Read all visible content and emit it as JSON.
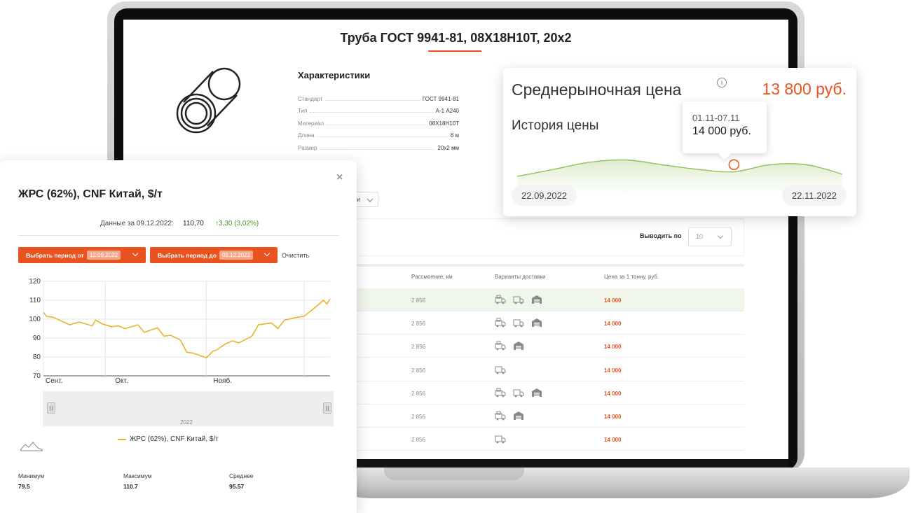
{
  "product": {
    "title": "Труба ГОСТ 9941-81, 08Х18Н10Т, 20х2",
    "chars_title": "Характеристики",
    "chars": [
      {
        "k": "Стандарт",
        "v": "ГОСТ 9941-81"
      },
      {
        "k": "Тип",
        "v": "А-1 А240"
      },
      {
        "k": "Материал",
        "v": "08Х18Н10Т"
      },
      {
        "k": "Длина",
        "v": "8 м"
      },
      {
        "k": "Размер",
        "v": "20х2 мм"
      }
    ]
  },
  "filters": {
    "dropdown_fragment": "и",
    "per_page_label": "Выводить по",
    "per_page_value": "10"
  },
  "table": {
    "headers": [
      "Рассмояние, км",
      "Варианты доставки",
      "Цена за 1 тонну, руб."
    ],
    "rows": [
      {
        "dist": "2 856",
        "price": "14 000",
        "delivery": [
          "truck-loading-icon",
          "truck-icon",
          "warehouse-icon"
        ]
      },
      {
        "dist": "2 856",
        "price": "14 000",
        "delivery": [
          "truck-loading-icon",
          "truck-icon",
          "warehouse-icon"
        ]
      },
      {
        "dist": "2 856",
        "price": "14 000",
        "delivery": [
          "truck-loading-icon",
          "warehouse-icon"
        ]
      },
      {
        "dist": "2 856",
        "price": "14 000",
        "delivery": [
          "truck-icon"
        ]
      },
      {
        "dist": "2 856",
        "price": "14 000",
        "delivery": [
          "truck-loading-icon",
          "truck-icon",
          "warehouse-icon"
        ]
      },
      {
        "dist": "2 856",
        "price": "14 000",
        "delivery": [
          "truck-loading-icon",
          "warehouse-icon"
        ]
      },
      {
        "dist": "2 856",
        "price": "14 000",
        "delivery": [
          "truck-icon"
        ]
      }
    ]
  },
  "price_card": {
    "title": "Среднерыночная цена",
    "info": "i",
    "price": "13 800 руб.",
    "history_label": "История цены",
    "tooltip_date": "01.11-07.11",
    "tooltip_price": "14 000 руб.",
    "date_start": "22.09.2022",
    "date_end": "22.11.2022",
    "line_color": "#8fbf57",
    "marker_color": "#e8531f"
  },
  "ore_card": {
    "close": "×",
    "title": "ЖРС (62%), CNF Китай, $/т",
    "data_label": "Данные за 09.12.2022:",
    "data_value": "110,70",
    "data_change": "↑3,30 (3,02%)",
    "btn_from_label": "Выбрать период от",
    "btn_from_date": "12.09.2022",
    "btn_to_label": "Выбрать период до",
    "btn_to_date": "09.12.2022",
    "clear_label": "Очистить",
    "nav_year": "2022",
    "legend": "ЖРС (62%), CNF Китай, $/т",
    "stats": [
      {
        "label": "Минимум",
        "value": "79.5"
      },
      {
        "label": "Максимум",
        "value": "110.7"
      },
      {
        "label": "Среднее",
        "value": "95.57"
      }
    ],
    "accent": "#e8531f"
  },
  "chart_data": [
    {
      "type": "line",
      "title": "ЖРС (62%), CNF Китай, $/т",
      "xlabel": "",
      "ylabel": "",
      "ylim": [
        70,
        120
      ],
      "yticks": [
        70,
        80,
        90,
        100,
        110,
        120
      ],
      "xtick_labels": [
        "Сент.",
        "Окт.",
        "Нояб."
      ],
      "grid": true,
      "legend": "bottom",
      "series": [
        {
          "name": "ЖРС (62%), CNF Китай, $/т",
          "color": "#e6b52a",
          "x": [
            "2022-09-12",
            "2022-09-13",
            "2022-09-15",
            "2022-09-20",
            "2022-09-23",
            "2022-09-27",
            "2022-09-28",
            "2022-09-30",
            "2022-10-03",
            "2022-10-05",
            "2022-10-07",
            "2022-10-11",
            "2022-10-13",
            "2022-10-17",
            "2022-10-19",
            "2022-10-21",
            "2022-10-24",
            "2022-10-26",
            "2022-10-28",
            "2022-11-01",
            "2022-11-03",
            "2022-11-04",
            "2022-11-07",
            "2022-11-09",
            "2022-11-11",
            "2022-11-15",
            "2022-11-17",
            "2022-11-21",
            "2022-11-23",
            "2022-11-25",
            "2022-11-29",
            "2022-12-01",
            "2022-12-05",
            "2022-12-07",
            "2022-12-08",
            "2022-12-09"
          ],
          "y": [
            103.5,
            101.5,
            101.0,
            97.0,
            98.5,
            96.5,
            99.5,
            97.5,
            96.0,
            96.5,
            95.0,
            97.0,
            93.0,
            95.5,
            91.0,
            91.5,
            89.0,
            82.5,
            82.0,
            79.5,
            83.0,
            83.5,
            87.0,
            88.5,
            87.5,
            91.0,
            97.0,
            98.0,
            95.0,
            99.5,
            101.0,
            101.5,
            107.0,
            110.0,
            108.0,
            110.7
          ]
        }
      ]
    },
    {
      "type": "area",
      "title": "",
      "xlabel": "",
      "ylabel": "",
      "xtick_labels": [
        "22.09.2022",
        "22.11.2022"
      ],
      "grid": false,
      "legend": "none",
      "series": [
        {
          "color": "#8fbf57",
          "x": [
            "22.09",
            "29.09",
            "06.10",
            "13.10",
            "20.10",
            "27.10",
            "03.11",
            "10.11",
            "17.11",
            "22.11"
          ],
          "y": [
            13750,
            13900,
            14050,
            14100,
            14000,
            13900,
            13850,
            14000,
            14000,
            13800
          ]
        }
      ],
      "highlight": {
        "x": "03.11",
        "y": 14000,
        "label": "01.11-07.11"
      }
    }
  ]
}
